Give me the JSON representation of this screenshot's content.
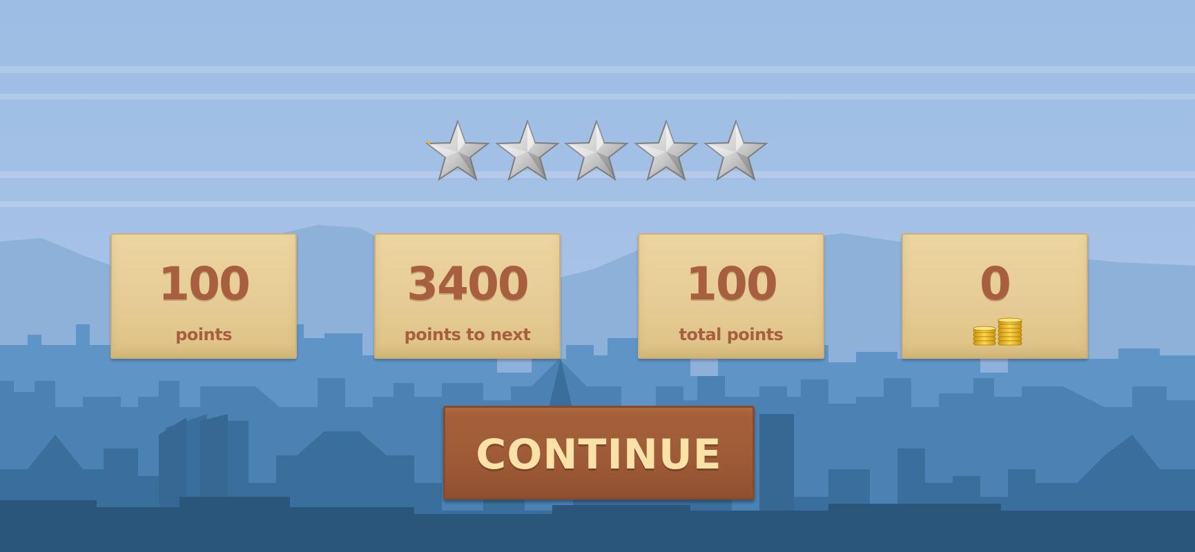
{
  "rating": {
    "stars_earned": 0,
    "stars_total": 5
  },
  "stats": [
    {
      "value": "100",
      "label": "points"
    },
    {
      "value": "3400",
      "label": "points to next"
    },
    {
      "value": "100",
      "label": "total points"
    },
    {
      "value": "0",
      "label": ""
    }
  ],
  "continue_button": {
    "label": "CONTINUE"
  },
  "colors": {
    "sky": "#9dbde4",
    "mountains": "#8eb1da",
    "city_back": "#5f95c6",
    "city_front": "#3b6f9b",
    "ground": "#2a567c",
    "card": "#e8cf99",
    "card_text": "#a85f3f",
    "button": "#a05b38",
    "button_text": "#fbe1a6",
    "star_silver": "#d9d9d9",
    "coin_gold": "#f2c21b"
  },
  "icons": {
    "star": "star-icon",
    "coins": "coin-stack-icon"
  }
}
